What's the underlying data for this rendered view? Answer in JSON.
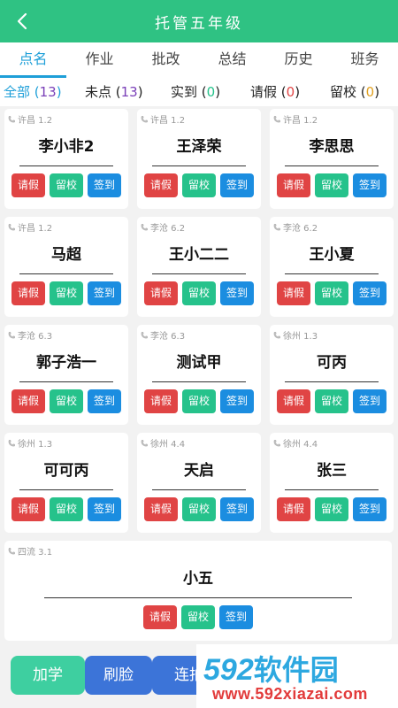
{
  "header": {
    "title": "托管五年级"
  },
  "tabs": [
    "点名",
    "作业",
    "批改",
    "总结",
    "历史",
    "班务"
  ],
  "filters": [
    {
      "label": "全部",
      "count": "13",
      "color": "#1e9fd8",
      "count_color": "#7a3fb8"
    },
    {
      "label": "未点",
      "count": "13",
      "color": "#222222",
      "count_color": "#7a3fb8"
    },
    {
      "label": "实到",
      "count": "0",
      "color": "#222222",
      "count_color": "#26c28b"
    },
    {
      "label": "请假",
      "count": "0",
      "color": "#222222",
      "count_color": "#e04444"
    },
    {
      "label": "留校",
      "count": "0",
      "color": "#222222",
      "count_color": "#e0a020"
    }
  ],
  "buttons": {
    "leave": "请假",
    "stay": "留校",
    "signin": "签到"
  },
  "students": [
    {
      "loc": "许昌 1.2",
      "name": "李小非2"
    },
    {
      "loc": "许昌 1.2",
      "name": "王泽荣"
    },
    {
      "loc": "许昌 1.2",
      "name": "李思思"
    },
    {
      "loc": "许昌 1.2",
      "name": "马超"
    },
    {
      "loc": "李沧 6.2",
      "name": "王小二二"
    },
    {
      "loc": "李沧 6.2",
      "name": "王小夏"
    },
    {
      "loc": "李沧 6.3",
      "name": "郭子浩一"
    },
    {
      "loc": "李沧 6.3",
      "name": "测试甲"
    },
    {
      "loc": "徐州 1.3",
      "name": "可丙"
    },
    {
      "loc": "徐州 1.3",
      "name": "可可丙"
    },
    {
      "loc": "徐州 4.4",
      "name": "天启"
    },
    {
      "loc": "徐州 4.4",
      "name": "张三"
    },
    {
      "loc": "四流 3.1",
      "name": "小五"
    }
  ],
  "bottom": {
    "add": "加学",
    "face": "刷脸",
    "snap": "连拍"
  },
  "watermark": {
    "logo_num": "592",
    "logo_text": "软件园",
    "url": "www.592xiazai.com"
  }
}
